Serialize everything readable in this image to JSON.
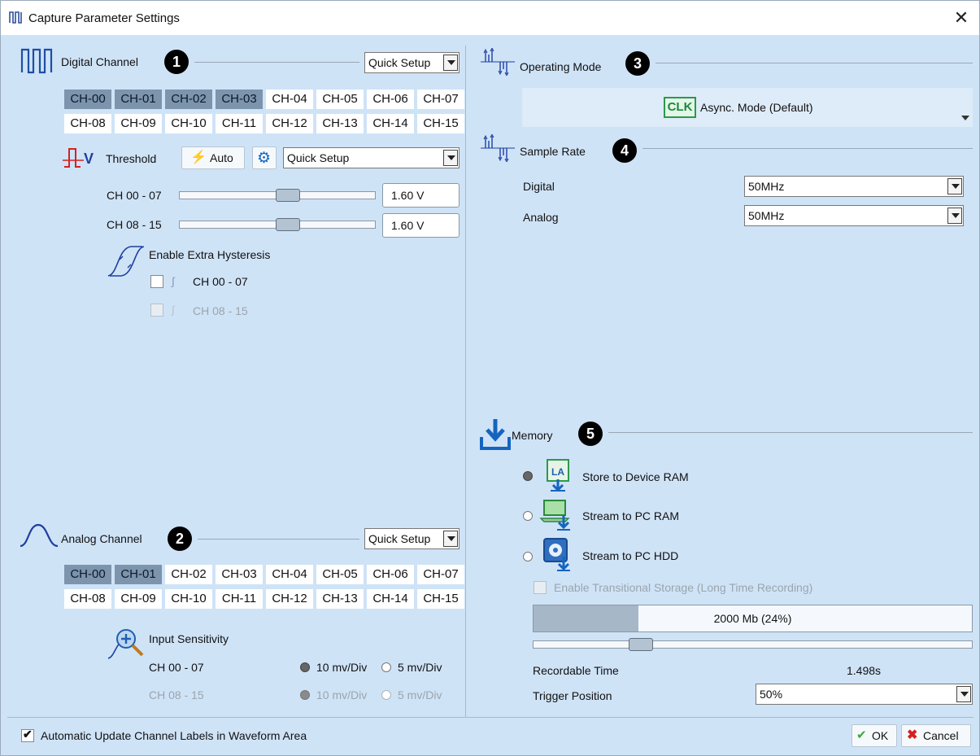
{
  "window": {
    "title": "Capture Parameter Settings",
    "close_glyph": "✕"
  },
  "digital": {
    "title": "Digital Channel",
    "badge": "1",
    "quick_setup": "Quick Setup",
    "channels_row1": [
      "CH-00",
      "CH-01",
      "CH-02",
      "CH-03",
      "CH-04",
      "CH-05",
      "CH-06",
      "CH-07"
    ],
    "channels_row2": [
      "CH-08",
      "CH-09",
      "CH-10",
      "CH-11",
      "CH-12",
      "CH-13",
      "CH-14",
      "CH-15"
    ],
    "selected_row1": [
      true,
      true,
      true,
      true,
      false,
      false,
      false,
      false
    ],
    "threshold": {
      "label": "Threshold",
      "auto_label": "Auto",
      "preset": "Quick Setup",
      "rows": [
        {
          "label": "CH 00 - 07",
          "value": "1.60 V",
          "level": 0.56
        },
        {
          "label": "CH 08 - 15",
          "value": "1.60 V",
          "level": 0.56
        }
      ]
    },
    "hysteresis": {
      "title": "Enable Extra Hysteresis",
      "items": [
        {
          "label": "CH 00 - 07",
          "enabled": true
        },
        {
          "label": "CH 08 - 15",
          "enabled": false
        }
      ]
    }
  },
  "analog": {
    "title": "Analog Channel",
    "badge": "2",
    "quick_setup": "Quick Setup",
    "channels_row1": [
      "CH-00",
      "CH-01",
      "CH-02",
      "CH-03",
      "CH-04",
      "CH-05",
      "CH-06",
      "CH-07"
    ],
    "channels_row2": [
      "CH-08",
      "CH-09",
      "CH-10",
      "CH-11",
      "CH-12",
      "CH-13",
      "CH-14",
      "CH-15"
    ],
    "selected_row1": [
      true,
      true,
      false,
      false,
      false,
      false,
      false,
      false
    ],
    "sensitivity": {
      "title": "Input Sensitivity",
      "rows": [
        {
          "label": "CH 00 - 07",
          "opt1": "10 mv/Div",
          "opt2": "5 mv/Div",
          "selected": "10 mv/Div",
          "enabled": true
        },
        {
          "label": "CH 08 - 15",
          "opt1": "10 mv/Div",
          "opt2": "5 mv/Div",
          "selected": "10 mv/Div",
          "enabled": false
        }
      ]
    }
  },
  "operating_mode": {
    "title": "Operating Mode",
    "badge": "3",
    "clk_text": "CLK",
    "value": "Async. Mode (Default)"
  },
  "sample_rate": {
    "title": "Sample Rate",
    "badge": "4",
    "digital_label": "Digital",
    "digital_value": "50MHz",
    "analog_label": "Analog",
    "analog_value": "50MHz"
  },
  "memory": {
    "title": "Memory",
    "badge": "5",
    "options": [
      {
        "label": "Store to Device RAM",
        "selected": true,
        "icon_text": "LA"
      },
      {
        "label": "Stream to PC RAM",
        "selected": false,
        "icon_text": ""
      },
      {
        "label": "Stream to PC HDD",
        "selected": false,
        "icon_text": ""
      }
    ],
    "transitional_label": "Enable Transitional Storage (Long Time Recording)",
    "bar_text": "2000 Mb (24%)",
    "bar_fraction": 0.24,
    "slider_level": 0.23,
    "recordable_label": "Recordable Time",
    "recordable_value": "1.498s",
    "trigger_label": "Trigger Position",
    "trigger_value": "50%"
  },
  "footer": {
    "auto_update_label": "Automatic Update Channel Labels in Waveform Area",
    "auto_update_checked": true,
    "ok_label": "OK",
    "cancel_label": "Cancel"
  },
  "colors": {
    "background": "#cfe3f7",
    "selected_channel": "#7d94ad",
    "accent_blue": "#1565c0"
  }
}
